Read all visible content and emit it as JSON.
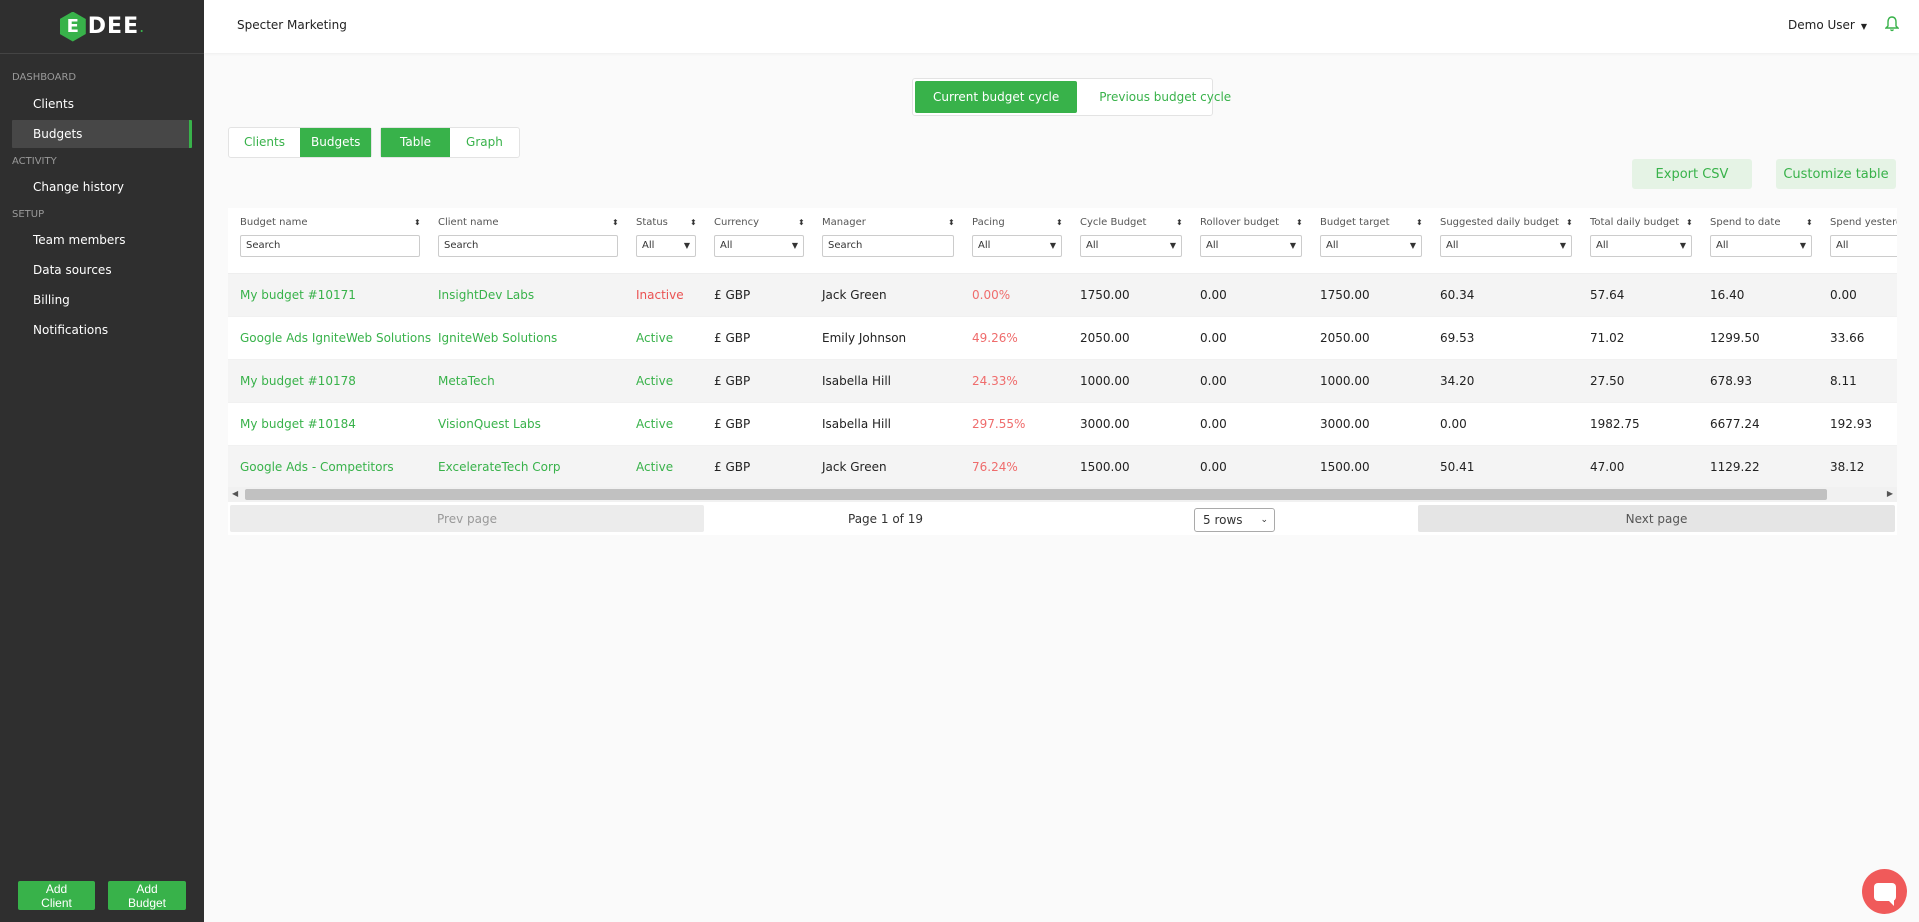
{
  "sidebar": {
    "logo_mark": "E",
    "logo_text": "DEE",
    "sections": [
      {
        "title": "DASHBOARD",
        "items": [
          "Clients",
          "Budgets"
        ]
      },
      {
        "title": "ACTIVITY",
        "items": [
          "Change history"
        ]
      },
      {
        "title": "SETUP",
        "items": [
          "Team members",
          "Data sources",
          "Billing",
          "Notifications"
        ]
      }
    ],
    "active_item": "Budgets",
    "buttons": {
      "add_client": "Add Client",
      "add_budget": "Add Budget"
    }
  },
  "header": {
    "workspace": "Specter Marketing",
    "user": "Demo User"
  },
  "cycle_toggle": {
    "current": "Current budget cycle",
    "previous": "Previous budget cycle",
    "active": "current"
  },
  "view_toggle": {
    "clients": "Clients",
    "budgets": "Budgets",
    "active": "budgets"
  },
  "display_toggle": {
    "table": "Table",
    "graph": "Graph",
    "active": "table"
  },
  "actions": {
    "export_csv": "Export CSV",
    "customize_table": "Customize table"
  },
  "table": {
    "columns": [
      {
        "label": "Budget name",
        "filter": "Search"
      },
      {
        "label": "Client name",
        "filter": "Search"
      },
      {
        "label": "Status",
        "filter": "All"
      },
      {
        "label": "Currency",
        "filter": "All"
      },
      {
        "label": "Manager",
        "filter": "Search"
      },
      {
        "label": "Pacing",
        "filter": "All"
      },
      {
        "label": "Cycle Budget",
        "filter": "All"
      },
      {
        "label": "Rollover budget",
        "filter": "All"
      },
      {
        "label": "Budget target",
        "filter": "All"
      },
      {
        "label": "Suggested daily budget",
        "filter": "All"
      },
      {
        "label": "Total daily budget",
        "filter": "All"
      },
      {
        "label": "Spend to date",
        "filter": "All"
      },
      {
        "label": "Spend yesterd",
        "filter": "All"
      }
    ],
    "rows": [
      [
        "My budget #10171",
        "InsightDev Labs",
        "Inactive",
        "£ GBP",
        "Jack Green",
        "0.00%",
        "1750.00",
        "0.00",
        "1750.00",
        "60.34",
        "57.64",
        "16.40",
        "0.00"
      ],
      [
        "Google Ads IgniteWeb Solutions",
        "IgniteWeb Solutions",
        "Active",
        "£ GBP",
        "Emily Johnson",
        "49.26%",
        "2050.00",
        "0.00",
        "2050.00",
        "69.53",
        "71.02",
        "1299.50",
        "33.66"
      ],
      [
        "My budget #10178",
        "MetaTech",
        "Active",
        "£ GBP",
        "Isabella Hill",
        "24.33%",
        "1000.00",
        "0.00",
        "1000.00",
        "34.20",
        "27.50",
        "678.93",
        "8.11"
      ],
      [
        "My budget #10184",
        "VisionQuest Labs",
        "Active",
        "£ GBP",
        "Isabella Hill",
        "297.55%",
        "3000.00",
        "0.00",
        "3000.00",
        "0.00",
        "1982.75",
        "6677.24",
        "192.93"
      ],
      [
        "Google Ads - Competitors",
        "ExcelerateTech Corp",
        "Active",
        "£ GBP",
        "Jack Green",
        "76.24%",
        "1500.00",
        "0.00",
        "1500.00",
        "50.41",
        "47.00",
        "1129.22",
        "38.12"
      ]
    ]
  },
  "pagination": {
    "prev": "Prev page",
    "info": "Page 1 of 19",
    "rows": "5 rows",
    "next": "Next page"
  },
  "colors": {
    "accent": "#38b24a",
    "inactive": "#ea5252",
    "sidebar": "#2f2f2f"
  }
}
